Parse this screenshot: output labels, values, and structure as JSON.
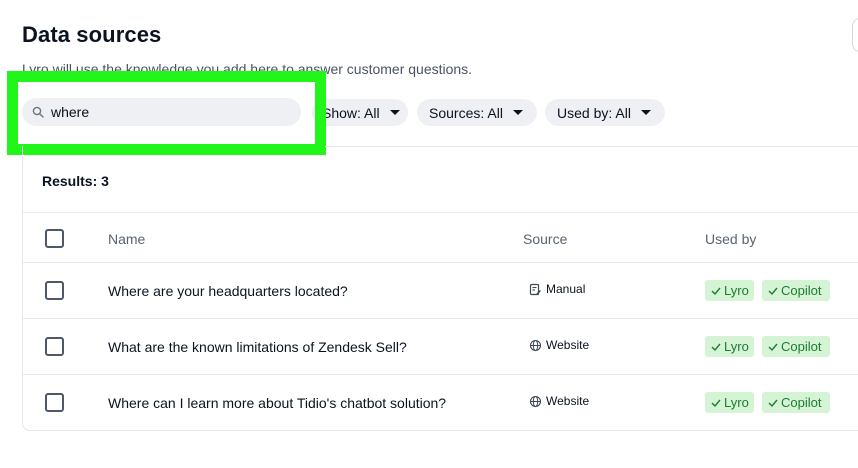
{
  "header": {
    "title": "Data sources",
    "subtitle": "Lyro will use the knowledge you add here to answer customer questions."
  },
  "search": {
    "value": "where",
    "icon": "search-icon"
  },
  "filters": {
    "show": "Show: All",
    "sources": "Sources: All",
    "used_by": "Used by: All"
  },
  "results_label": "Results: 3",
  "table": {
    "columns": {
      "name": "Name",
      "source": "Source",
      "used_by": "Used by"
    },
    "rows": [
      {
        "name": "Where are your headquarters located?",
        "source": "Manual",
        "source_icon": "manual-icon",
        "used_by": [
          "Lyro",
          "Copilot"
        ]
      },
      {
        "name": "What are the known limitations of Zendesk Sell?",
        "source": "Website",
        "source_icon": "globe-icon",
        "used_by": [
          "Lyro",
          "Copilot"
        ]
      },
      {
        "name": "Where can I learn more about Tidio's chatbot solution?",
        "source": "Website",
        "source_icon": "globe-icon",
        "used_by": [
          "Lyro",
          "Copilot"
        ]
      }
    ]
  },
  "colors": {
    "highlight": "#22f51a",
    "badge_bg": "#d5f4d6",
    "badge_text": "#1d7c2f"
  }
}
